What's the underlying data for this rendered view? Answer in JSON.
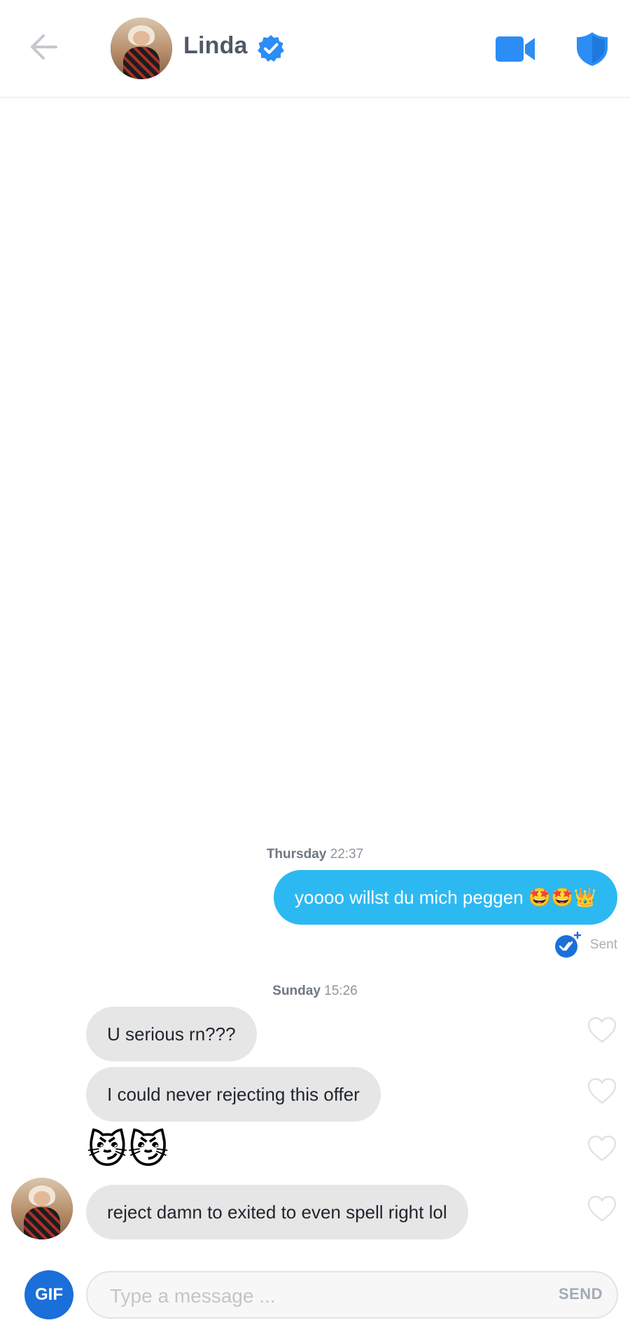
{
  "header": {
    "name": "Linda",
    "back_icon": "arrow-left-icon",
    "verified_icon": "verified-check-icon",
    "video_icon": "video-camera-icon",
    "safety_icon": "shield-icon",
    "accent_color": "#2b8df5"
  },
  "messages": {
    "thursday": {
      "day": "Thursday",
      "time": "22:37"
    },
    "outgoing_1": "yoooo willst du mich peggen 🤩🤩👑",
    "sent_status": "Sent",
    "sunday": {
      "day": "Sunday",
      "time": "15:26"
    },
    "incoming_1": "U serious rn???",
    "incoming_2": "I could never rejecting this offer",
    "incoming_3": "😼😼",
    "incoming_4": "reject damn to exited to even spell right lol",
    "like_icon": "heart-outline-icon",
    "outgoing_color": "#2cb9f2",
    "incoming_color": "#e6e6e6"
  },
  "composer": {
    "gif_label": "GIF",
    "placeholder": "Type a message ...",
    "send_label": "SEND",
    "gif_color": "#1b6fd8"
  }
}
